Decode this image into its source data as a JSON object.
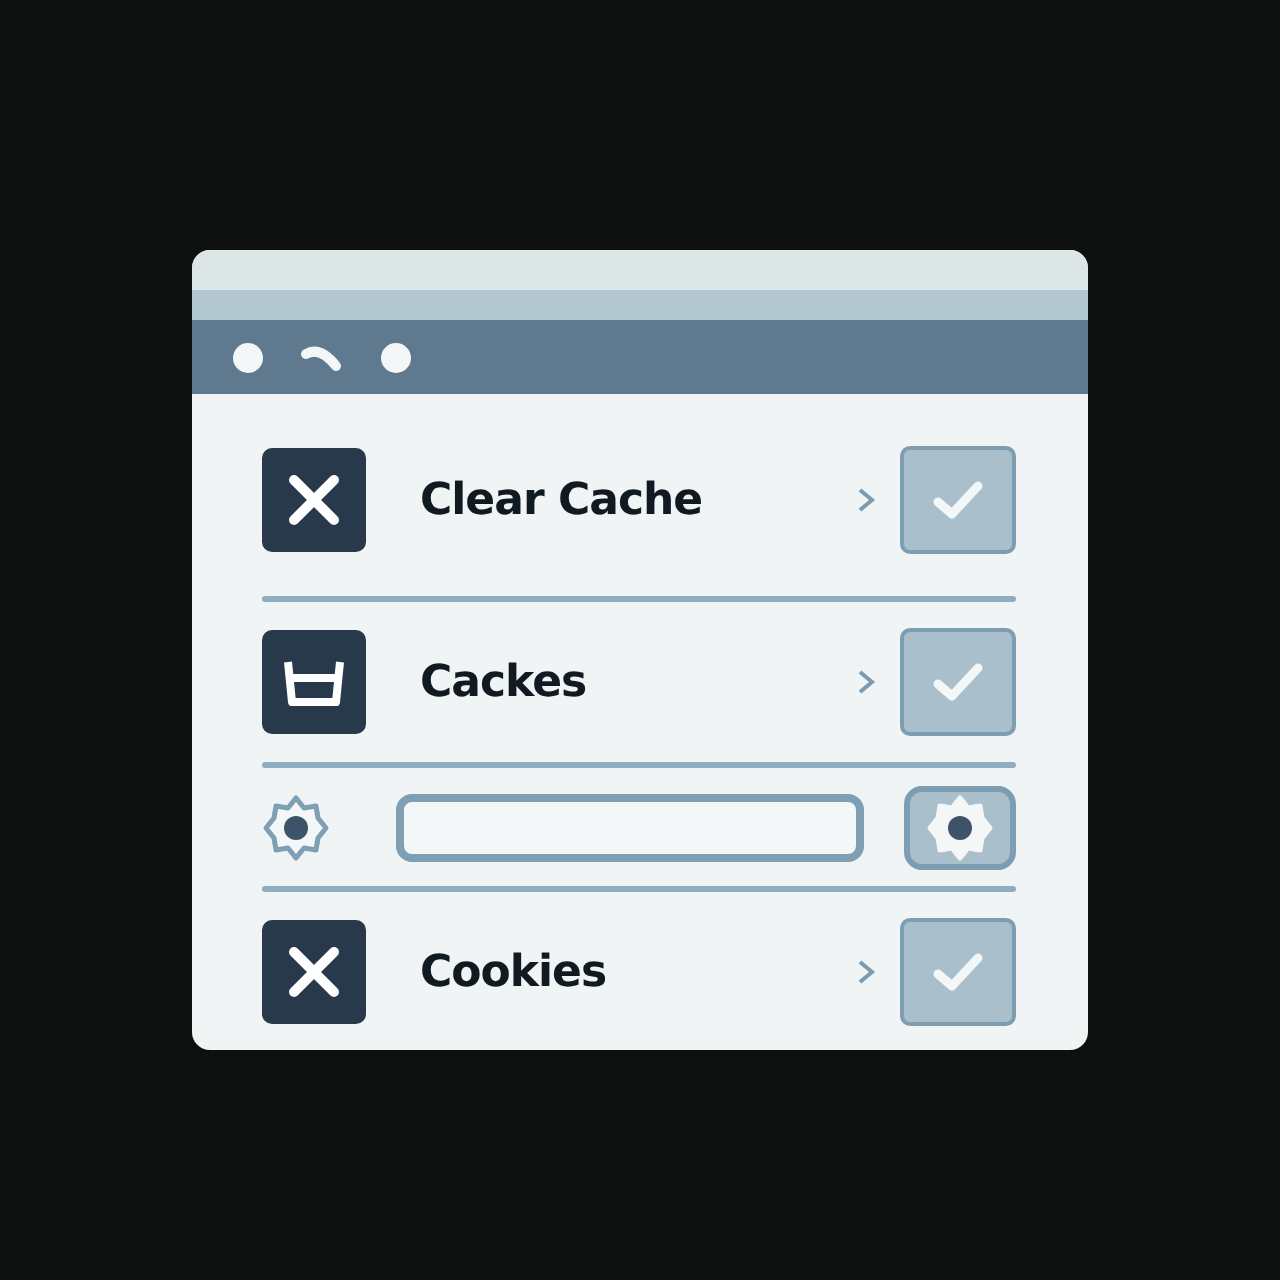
{
  "rows": [
    {
      "kind": "cross",
      "label": "Clear Cache",
      "checked": true
    },
    {
      "kind": "basket",
      "label": "Cackes",
      "checked": true
    },
    {
      "kind": "field"
    },
    {
      "kind": "cross",
      "label": "Cookies",
      "checked": true
    }
  ]
}
